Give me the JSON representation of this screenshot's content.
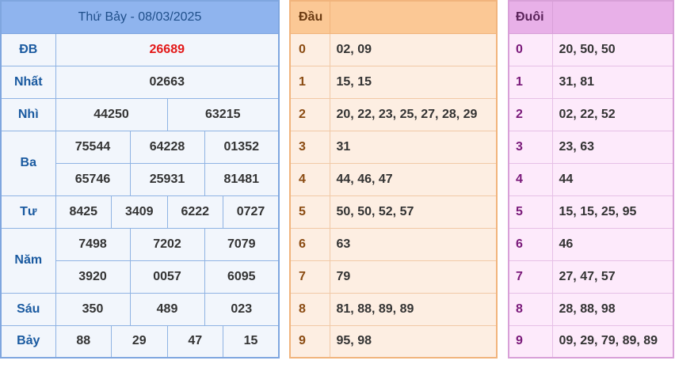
{
  "results": {
    "title": "Thứ Bảy - 08/03/2025",
    "rows": [
      {
        "label": "ĐB",
        "values": [
          "26689"
        ]
      },
      {
        "label": "Nhất",
        "values": [
          "02663"
        ]
      },
      {
        "label": "Nhì",
        "values": [
          "44250",
          "63215"
        ]
      },
      {
        "label": "Ba",
        "values": [
          "75544",
          "64228",
          "01352",
          "65746",
          "25931",
          "81481"
        ]
      },
      {
        "label": "Tư",
        "values": [
          "8425",
          "3409",
          "6222",
          "0727"
        ]
      },
      {
        "label": "Năm",
        "values": [
          "7498",
          "7202",
          "7079",
          "3920",
          "0057",
          "6095"
        ]
      },
      {
        "label": "Sáu",
        "values": [
          "350",
          "489",
          "023"
        ]
      },
      {
        "label": "Bảy",
        "values": [
          "88",
          "29",
          "47",
          "15"
        ]
      }
    ]
  },
  "dau": {
    "header": "Đầu",
    "rows": [
      {
        "key": "0",
        "values": "02, 09"
      },
      {
        "key": "1",
        "values": "15, 15"
      },
      {
        "key": "2",
        "values": "20, 22, 23, 25, 27, 28, 29"
      },
      {
        "key": "3",
        "values": "31"
      },
      {
        "key": "4",
        "values": "44, 46, 47"
      },
      {
        "key": "5",
        "values": "50, 50, 52, 57"
      },
      {
        "key": "6",
        "values": "63"
      },
      {
        "key": "7",
        "values": "79"
      },
      {
        "key": "8",
        "values": "81, 88, 89, 89"
      },
      {
        "key": "9",
        "values": "95, 98"
      }
    ]
  },
  "duoi": {
    "header": "Đuôi",
    "rows": [
      {
        "key": "0",
        "values": "20, 50, 50"
      },
      {
        "key": "1",
        "values": "31, 81"
      },
      {
        "key": "2",
        "values": "02, 22, 52"
      },
      {
        "key": "3",
        "values": "23, 63"
      },
      {
        "key": "4",
        "values": "44"
      },
      {
        "key": "5",
        "values": "15, 15, 25, 95"
      },
      {
        "key": "6",
        "values": "46"
      },
      {
        "key": "7",
        "values": "27, 47, 57"
      },
      {
        "key": "8",
        "values": "28, 88, 98"
      },
      {
        "key": "9",
        "values": "09, 29, 79, 89, 89"
      }
    ]
  },
  "colors": {
    "special_prize": "#e31919",
    "results_header": "#8fb4ee",
    "dau_header": "#fbc895",
    "duoi_header": "#e8b0e8"
  }
}
